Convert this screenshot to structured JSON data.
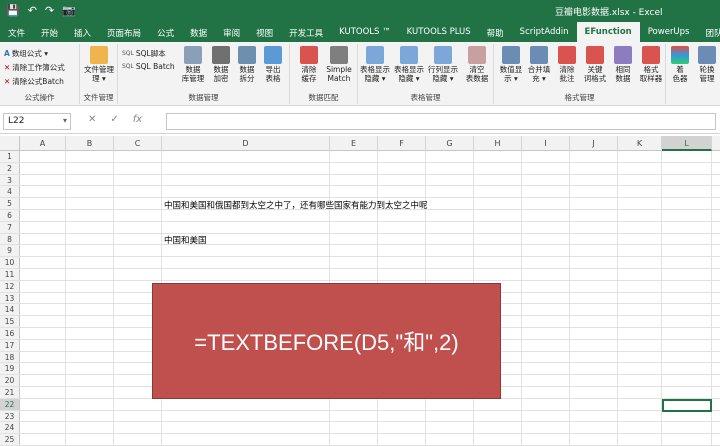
{
  "window": {
    "title": "豆瓣电影数据.xlsx - Excel"
  },
  "quick_access": [
    "save-icon",
    "undo-icon",
    "redo-icon",
    "camera-icon"
  ],
  "tabs": [
    {
      "label": "文件"
    },
    {
      "label": "开始"
    },
    {
      "label": "插入"
    },
    {
      "label": "页面布局"
    },
    {
      "label": "公式"
    },
    {
      "label": "数据"
    },
    {
      "label": "审阅"
    },
    {
      "label": "视图"
    },
    {
      "label": "开发工具"
    },
    {
      "label": "KUTOOLS ™"
    },
    {
      "label": "KUTOOLS PLUS"
    },
    {
      "label": "帮助"
    },
    {
      "label": "ScriptAddin"
    },
    {
      "label": "EFunction"
    },
    {
      "label": "PowerUps"
    },
    {
      "label": "团队"
    }
  ],
  "active_tab": "EFunction",
  "ribbon": {
    "formula_ops": {
      "items": [
        "数组公式 ▾",
        "清除工作簿公式",
        "清除公式Batch"
      ],
      "label": "公式操作"
    },
    "file_mgmt": {
      "button": "文件管理",
      "button2": "理 ▾",
      "label": "文件管理"
    },
    "data_mgmt": {
      "sql_items": [
        "SQL脚本",
        "SQL Batch"
      ],
      "buttons": [
        {
          "l1": "数据",
          "l2": "库管理"
        },
        {
          "l1": "数据",
          "l2": "加密"
        },
        {
          "l1": "数据",
          "l2": "拆分"
        },
        {
          "l1": "导出",
          "l2": "表格"
        }
      ],
      "label": "数据管理"
    },
    "data_match": {
      "buttons": [
        {
          "l1": "清除",
          "l2": "缓存"
        },
        {
          "l1": "Simple",
          "l2": "Match"
        }
      ],
      "label": "数据匹配"
    },
    "table_mgmt": {
      "buttons": [
        {
          "l1": "表格显示",
          "l2": "隐藏 ▾"
        },
        {
          "l1": "表格显示",
          "l2": "隐藏 ▾"
        },
        {
          "l1": "行列显示",
          "l2": "隐藏 ▾"
        },
        {
          "l1": "清空",
          "l2": "表数据"
        }
      ],
      "label": "表格管理"
    },
    "format_mgmt": {
      "buttons": [
        {
          "l1": "数值显",
          "l2": "示 ▾"
        },
        {
          "l1": "合并填",
          "l2": "充 ▾"
        },
        {
          "l1": "清除",
          "l2": "批注"
        },
        {
          "l1": "关键",
          "l2": "词格式"
        },
        {
          "l1": "相同",
          "l2": "数据"
        },
        {
          "l1": "格式",
          "l2": "取样器"
        }
      ],
      "label": "格式管理"
    },
    "extra": {
      "buttons": [
        {
          "l1": "着",
          "l2": "色器"
        },
        {
          "l1": "轮换",
          "l2": "管理"
        }
      ]
    }
  },
  "formula_bar": {
    "name_box": "L22",
    "formula": "",
    "fx_label": "fx"
  },
  "columns": [
    "A",
    "B",
    "C",
    "D",
    "E",
    "F",
    "G",
    "H",
    "I",
    "J",
    "K",
    "L"
  ],
  "selected_column": "L",
  "rows": [
    "1",
    "2",
    "3",
    "4",
    "5",
    "6",
    "7",
    "8",
    "9",
    "10",
    "11",
    "12",
    "13",
    "14",
    "15",
    "16",
    "17",
    "18",
    "19",
    "20",
    "21",
    "22",
    "23",
    "24",
    "25"
  ],
  "selected_row": "22",
  "cells": {
    "D5": "中国和美国和俄国都到太空之中了，还有哪些国家有能力到太空之中呢",
    "D8": "中国和美国"
  },
  "overlay_formula": "=TEXTBEFORE(D5,\"和\",2)",
  "colors": {
    "excel_green": "#217346",
    "overlay_fill": "#c0504d"
  }
}
